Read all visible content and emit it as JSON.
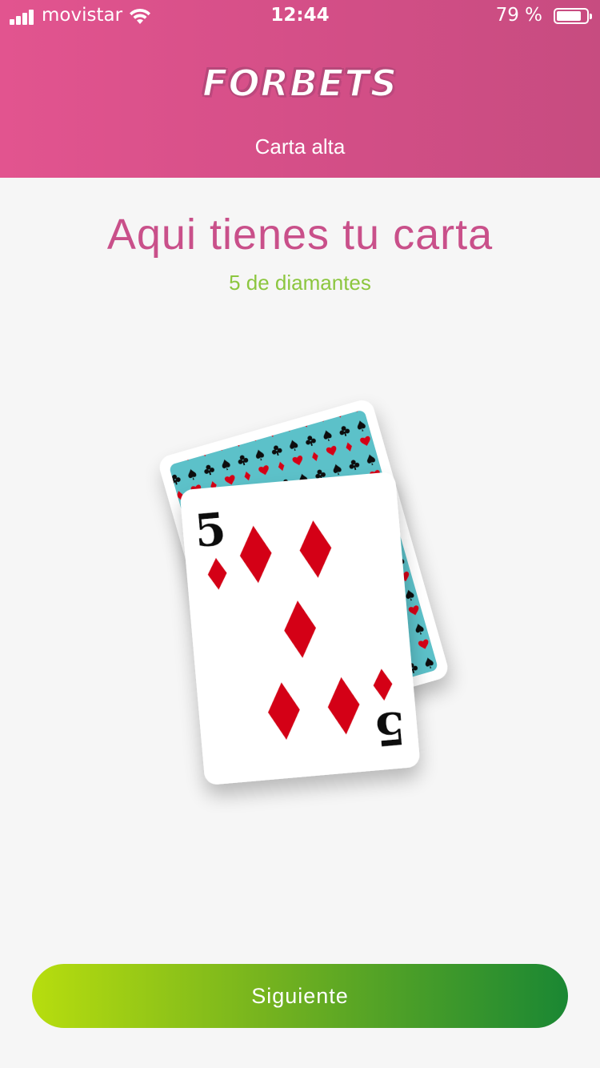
{
  "status_bar": {
    "carrier": "movistar",
    "time": "12:44",
    "battery_percent": "79 %",
    "battery_level": 0.79
  },
  "header": {
    "logo_text": "FORBETS",
    "subtitle": "Carta alta"
  },
  "main": {
    "title": "Aqui tienes tu carta",
    "card_name": "5 de diamantes",
    "card": {
      "rank": "5",
      "suit": "diamonds",
      "suit_color": "#d40018"
    }
  },
  "actions": {
    "next_label": "Siguiente"
  },
  "colors": {
    "header_accent": "#d24e86",
    "title": "#c9508a",
    "card_name": "#8cc63f",
    "button_start": "#b7dd0e",
    "button_end": "#1a8733",
    "card_back": "#5cc1c9"
  }
}
